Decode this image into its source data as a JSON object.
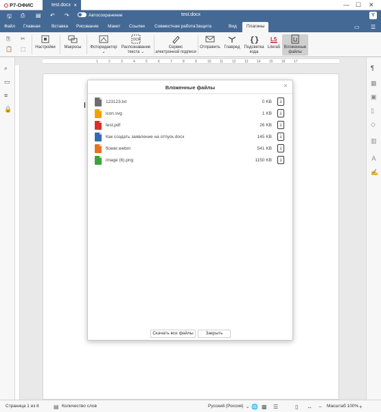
{
  "window": {
    "app_name": "Р7-ОФИС",
    "tab_title": "test.docx",
    "doc_title": "test.docx",
    "autosave_label": "Автосохранение",
    "user_initial": "Y",
    "accent": "#446995"
  },
  "menu": {
    "items": [
      "Файл",
      "Главная",
      "Вставка",
      "Рисование",
      "Макет",
      "Ссылки",
      "Совместная работа",
      "Защита",
      "Вид",
      "Плагины"
    ],
    "active": "Плагины"
  },
  "toolbar": {
    "settings": "Настройки",
    "macros": "Макросы",
    "photo_editor": "Фоторедактор",
    "ocr_line1": "Распознавание",
    "ocr_line2": "текста",
    "signature_line1": "Сервис",
    "signature_line2": "электронной подписи",
    "send": "Отправить",
    "glavred": "Главред",
    "code_line1": "Подсветка",
    "code_line2": "кода",
    "literab": "Litera5",
    "attached_line1": "Вложенные",
    "attached_line2": "файлы"
  },
  "ruler": {
    "marks": [
      "1",
      "2",
      "3",
      "4",
      "5",
      "6",
      "7",
      "8",
      "9",
      "10",
      "11",
      "12",
      "13",
      "14",
      "15",
      "16",
      "17"
    ]
  },
  "dialog": {
    "title": "Вложенные файлы",
    "files": [
      {
        "name": "123123.txt",
        "size": "0 KB",
        "icon": "txt-file-icon",
        "color": "#6d6d6d"
      },
      {
        "name": "icon.svg",
        "size": "1 KB",
        "icon": "svg-file-icon",
        "color": "#f2a100"
      },
      {
        "name": "test.pdf",
        "size": "26 KB",
        "icon": "pdf-file-icon",
        "color": "#d9302c"
      },
      {
        "name": "Как создать заявление на отпуск.docx",
        "size": "145 KB",
        "icon": "docx-file-icon",
        "color": "#2f6db5"
      },
      {
        "name": "flower.webm",
        "size": "541 KB",
        "icon": "video-file-icon",
        "color": "#e8731f"
      },
      {
        "name": "image (6).png",
        "size": "1150 KB",
        "icon": "image-file-icon",
        "color": "#3aa43a"
      }
    ],
    "download_all": "Скачать все файлы",
    "close": "Закрыть"
  },
  "status": {
    "page": "Страница 1 из 6",
    "word_count": "Количество слов",
    "language": "Русский (Россия)",
    "zoom": "Масштаб 100%"
  }
}
